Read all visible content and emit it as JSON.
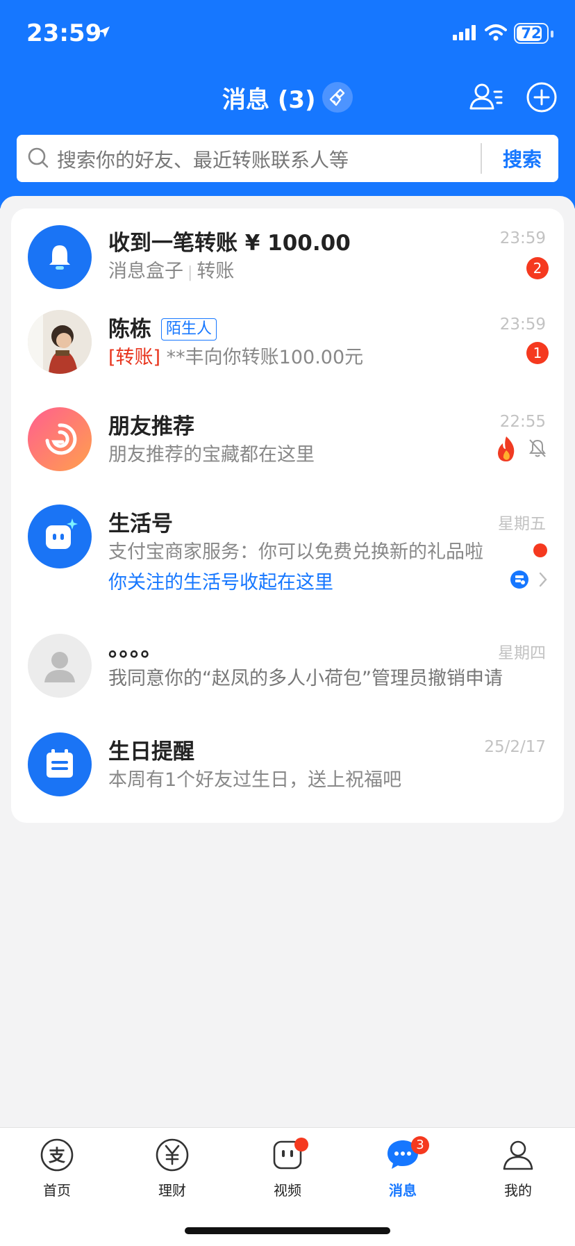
{
  "status_bar": {
    "time": "23:59",
    "battery": "72"
  },
  "header": {
    "title": "消息 (3)"
  },
  "search": {
    "placeholder": "搜索你的好友、最近转账联系人等",
    "button": "搜索"
  },
  "messages": [
    {
      "name": "收到一笔转账 ¥ 100.00",
      "sub_a": "消息盒子",
      "sub_b": "转账",
      "time": "23:59",
      "badge": "2",
      "avatar_icon": "bell-icon"
    },
    {
      "name": "陈栋",
      "tag": "陌生人",
      "sub_prefix": "[转账]",
      "sub": " **丰向你转账100.00元",
      "time": "23:59",
      "badge": "1",
      "avatar_icon": "user-photo"
    },
    {
      "name": "朋友推荐",
      "sub": "朋友推荐的宝藏都在这里",
      "time": "22:55",
      "avatar_icon": "friend-recommend-icon"
    },
    {
      "name": "生活号",
      "sub": "支付宝商家服务：你可以免费兑换新的礼品啦",
      "link": "你关注的生活号收起在这里",
      "time": "星期五",
      "avatar_icon": "lifestyle-account-icon"
    },
    {
      "name": "。。。。",
      "sub": "我同意你的“赵凤的多人小荷包”管理员撤销申请",
      "time": "星期四",
      "avatar_icon": "default-avatar-icon"
    },
    {
      "name": "生日提醒",
      "sub": "本周有1个好友过生日，送上祝福吧",
      "time": "25/2/17",
      "avatar_icon": "calendar-icon"
    }
  ],
  "tabs": [
    {
      "label": "首页",
      "icon": "alipay-home-icon"
    },
    {
      "label": "理财",
      "icon": "wealth-icon"
    },
    {
      "label": "视频",
      "icon": "video-icon"
    },
    {
      "label": "消息",
      "icon": "message-icon",
      "badge": "3",
      "active": true
    },
    {
      "label": "我的",
      "icon": "profile-icon"
    }
  ],
  "colors": {
    "brand": "#1677ff",
    "badge": "#f5391f"
  }
}
